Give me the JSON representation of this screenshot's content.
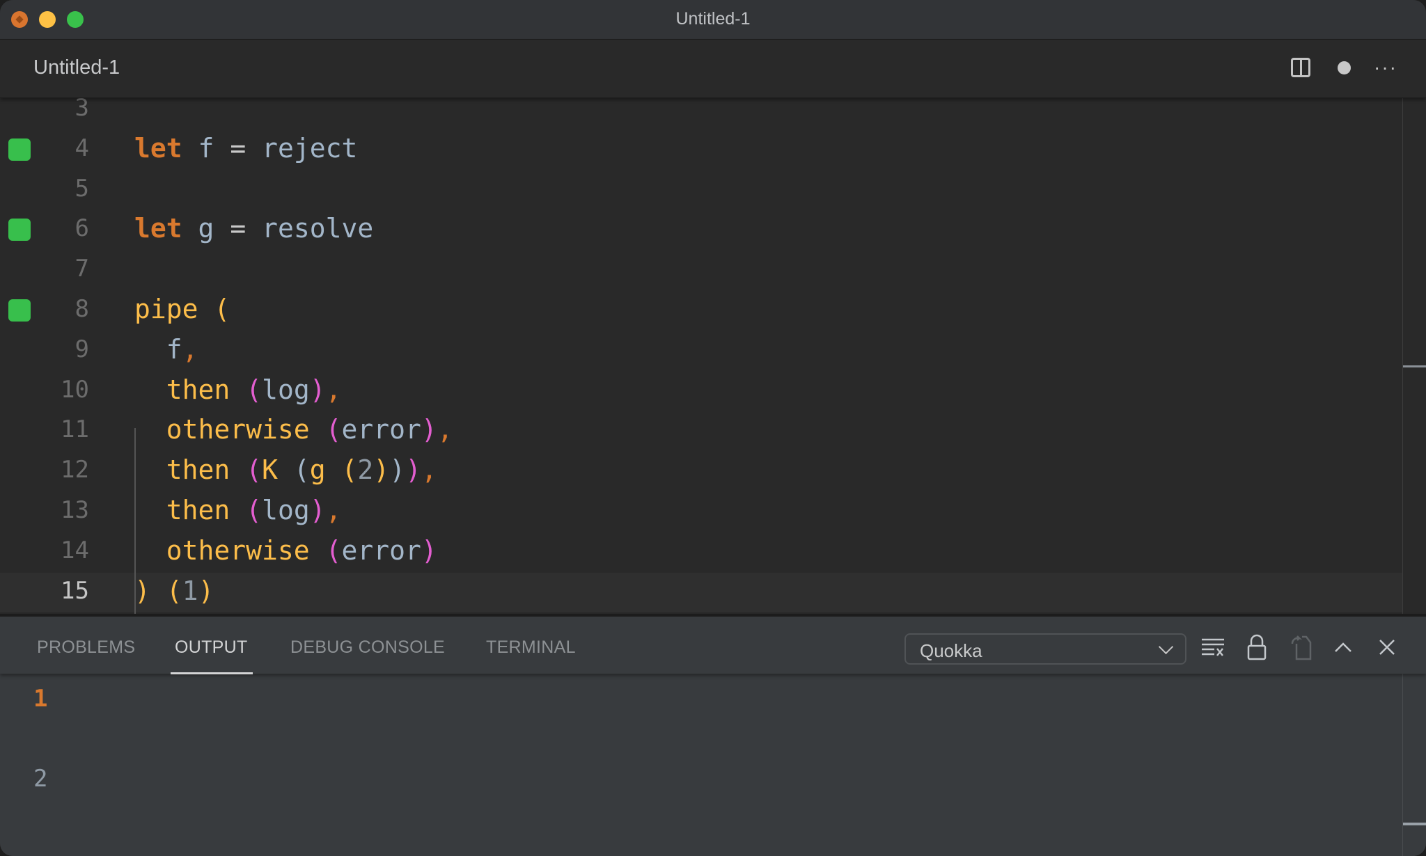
{
  "window": {
    "title": "Untitled-1",
    "traffic_lights": {
      "close_color": "#d9752f",
      "minimize_color": "#fec145",
      "maximize_color": "#39c14b"
    }
  },
  "editor_tab": {
    "label": "Untitled-1",
    "actions": [
      {
        "name": "split-editor-icon"
      },
      {
        "name": "unsaved-dot-icon"
      },
      {
        "name": "more-actions-icon",
        "glyph": "···"
      }
    ]
  },
  "editor": {
    "current_line": 15,
    "coverage_color": "#38bf4c",
    "lines": [
      {
        "number": "3",
        "covered": false,
        "tokens": []
      },
      {
        "number": "4",
        "covered": true,
        "tokens": [
          {
            "t": "let",
            "c": "kw"
          },
          {
            "t": " ",
            "c": "id"
          },
          {
            "t": "f",
            "c": "id"
          },
          {
            "t": " ",
            "c": "id"
          },
          {
            "t": "=",
            "c": "op"
          },
          {
            "t": " ",
            "c": "id"
          },
          {
            "t": "reject",
            "c": "id"
          }
        ]
      },
      {
        "number": "5",
        "covered": false,
        "tokens": []
      },
      {
        "number": "6",
        "covered": true,
        "tokens": [
          {
            "t": "let",
            "c": "kw"
          },
          {
            "t": " ",
            "c": "id"
          },
          {
            "t": "g",
            "c": "id"
          },
          {
            "t": " ",
            "c": "id"
          },
          {
            "t": "=",
            "c": "op"
          },
          {
            "t": " ",
            "c": "id"
          },
          {
            "t": "resolve",
            "c": "id"
          }
        ]
      },
      {
        "number": "7",
        "covered": false,
        "tokens": []
      },
      {
        "number": "8",
        "covered": true,
        "tokens": [
          {
            "t": "pipe",
            "c": "fn"
          },
          {
            "t": " ",
            "c": "id"
          },
          {
            "t": "(",
            "c": "p1"
          }
        ]
      },
      {
        "number": "9",
        "covered": false,
        "tokens": [
          {
            "t": "  ",
            "c": "id"
          },
          {
            "t": "f",
            "c": "id"
          },
          {
            "t": ",",
            "c": "comma"
          }
        ]
      },
      {
        "number": "10",
        "covered": false,
        "tokens": [
          {
            "t": "  ",
            "c": "id"
          },
          {
            "t": "then",
            "c": "fn"
          },
          {
            "t": " ",
            "c": "id"
          },
          {
            "t": "(",
            "c": "p2"
          },
          {
            "t": "log",
            "c": "id"
          },
          {
            "t": ")",
            "c": "p2"
          },
          {
            "t": ",",
            "c": "comma"
          }
        ]
      },
      {
        "number": "11",
        "covered": false,
        "tokens": [
          {
            "t": "  ",
            "c": "id"
          },
          {
            "t": "otherwise",
            "c": "fn"
          },
          {
            "t": " ",
            "c": "id"
          },
          {
            "t": "(",
            "c": "p2"
          },
          {
            "t": "error",
            "c": "id"
          },
          {
            "t": ")",
            "c": "p2"
          },
          {
            "t": ",",
            "c": "comma"
          }
        ]
      },
      {
        "number": "12",
        "covered": false,
        "tokens": [
          {
            "t": "  ",
            "c": "id"
          },
          {
            "t": "then",
            "c": "fn"
          },
          {
            "t": " ",
            "c": "id"
          },
          {
            "t": "(",
            "c": "p2"
          },
          {
            "t": "K",
            "c": "fn"
          },
          {
            "t": " ",
            "c": "id"
          },
          {
            "t": "(",
            "c": "p3"
          },
          {
            "t": "g",
            "c": "fn"
          },
          {
            "t": " ",
            "c": "id"
          },
          {
            "t": "(",
            "c": "p1"
          },
          {
            "t": "2",
            "c": "num"
          },
          {
            "t": ")",
            "c": "p1"
          },
          {
            "t": ")",
            "c": "p3"
          },
          {
            "t": ")",
            "c": "p2"
          },
          {
            "t": ",",
            "c": "comma"
          }
        ]
      },
      {
        "number": "13",
        "covered": false,
        "tokens": [
          {
            "t": "  ",
            "c": "id"
          },
          {
            "t": "then",
            "c": "fn"
          },
          {
            "t": " ",
            "c": "id"
          },
          {
            "t": "(",
            "c": "p2"
          },
          {
            "t": "log",
            "c": "id"
          },
          {
            "t": ")",
            "c": "p2"
          },
          {
            "t": ",",
            "c": "comma"
          }
        ]
      },
      {
        "number": "14",
        "covered": false,
        "tokens": [
          {
            "t": "  ",
            "c": "id"
          },
          {
            "t": "otherwise",
            "c": "fn"
          },
          {
            "t": " ",
            "c": "id"
          },
          {
            "t": "(",
            "c": "p2"
          },
          {
            "t": "error",
            "c": "id"
          },
          {
            "t": ")",
            "c": "p2"
          }
        ]
      },
      {
        "number": "15",
        "covered": false,
        "tokens": [
          {
            "t": ")",
            "c": "p1"
          },
          {
            "t": " ",
            "c": "id"
          },
          {
            "t": "(",
            "c": "p1"
          },
          {
            "t": "1",
            "c": "num"
          },
          {
            "t": ")",
            "c": "p1"
          }
        ]
      }
    ]
  },
  "panel": {
    "tabs": [
      {
        "label": "PROBLEMS",
        "active": false
      },
      {
        "label": "OUTPUT",
        "active": true
      },
      {
        "label": "DEBUG CONSOLE",
        "active": false
      },
      {
        "label": "TERMINAL",
        "active": false
      }
    ],
    "channel_select": {
      "value": "Quokka"
    },
    "actions": [
      {
        "name": "clear-output-icon"
      },
      {
        "name": "lock-scroll-icon"
      },
      {
        "name": "open-log-file-icon",
        "disabled": true
      },
      {
        "name": "maximize-panel-icon"
      },
      {
        "name": "close-panel-icon"
      }
    ],
    "output_lines": [
      {
        "text": "1",
        "color": "#d9792e"
      },
      {
        "text": "2",
        "color": "#8f9aa5"
      }
    ]
  }
}
